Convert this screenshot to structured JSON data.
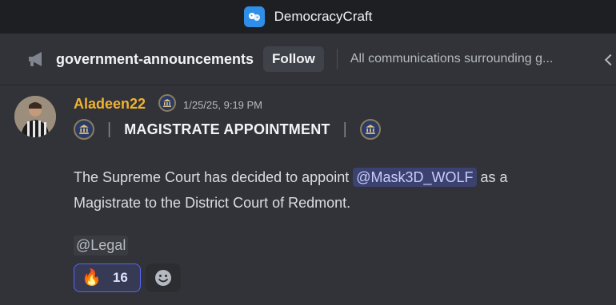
{
  "window": {
    "title": "DemocracyCraft"
  },
  "channel": {
    "name": "government-announcements",
    "follow_label": "Follow",
    "topic": "All communications surrounding g..."
  },
  "message": {
    "author": "Aladeen22",
    "timestamp": "1/25/25, 9:19 PM",
    "heading": "MAGISTRATE APPOINTMENT",
    "separator": "|",
    "body_part1": "The Supreme Court has decided to appoint",
    "mention": "@Mask3D_WOLF",
    "body_part2": "as a",
    "body_line2": "Magistrate to the District Court of Redmont.",
    "role_mention": "@Legal"
  },
  "reactions": [
    {
      "emoji": "🔥",
      "count": "16"
    }
  ],
  "colors": {
    "username": "#f0b232",
    "mention_bg": "#3c4270",
    "reaction_border": "#5865f2"
  }
}
